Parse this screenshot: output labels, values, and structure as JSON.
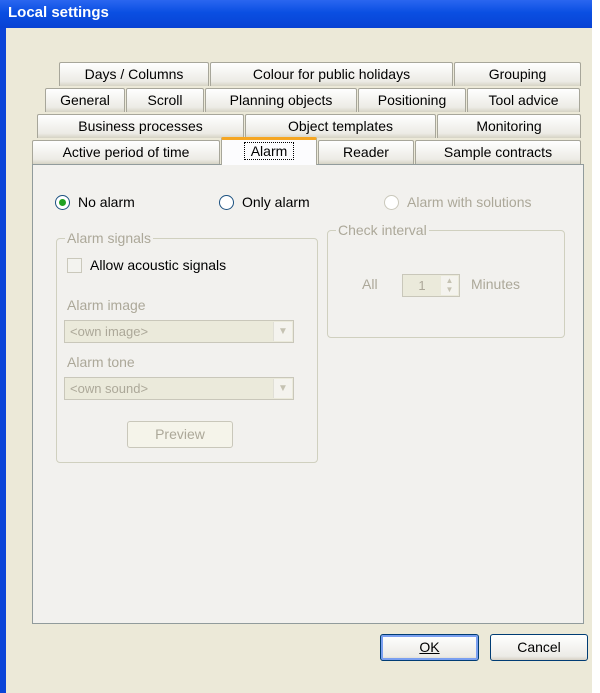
{
  "window": {
    "title": "Local settings"
  },
  "tabs": {
    "row1": [
      "Days / Columns",
      "Colour for public holidays",
      "Grouping"
    ],
    "row2": [
      "General",
      "Scroll",
      "Planning objects",
      "Positioning",
      "Tool advice"
    ],
    "row3": [
      "Business processes",
      "Object templates",
      "Monitoring"
    ],
    "row4": [
      "Active period of time",
      "Alarm",
      "Reader",
      "Sample contracts"
    ],
    "active": "Alarm"
  },
  "alarm": {
    "radios": {
      "no_alarm": "No alarm",
      "only_alarm": "Only alarm",
      "alarm_with_solutions": "Alarm with solutions",
      "selected": "No alarm"
    },
    "signals": {
      "legend": "Alarm signals",
      "allow_acoustic": "Allow acoustic signals",
      "image_label": "Alarm image",
      "image_value": "<own image>",
      "tone_label": "Alarm tone",
      "tone_value": "<own sound>",
      "preview": "Preview"
    },
    "interval": {
      "legend": "Check interval",
      "all": "All",
      "value": "1",
      "unit": "Minutes"
    }
  },
  "buttons": {
    "ok": "OK",
    "cancel": "Cancel"
  }
}
